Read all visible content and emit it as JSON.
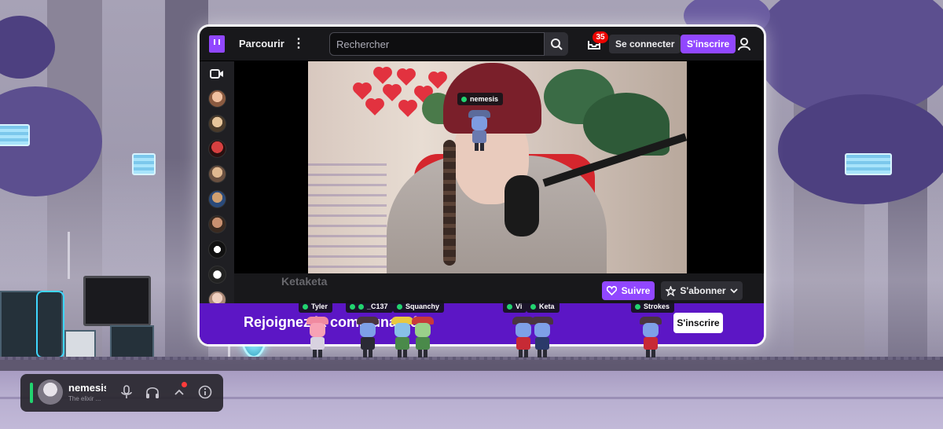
{
  "twitch": {
    "browse_label": "Parcourir",
    "search_placeholder": "Rechercher",
    "inbox_count": "35",
    "login_label": "Se connecter",
    "signup_label": "S'inscrire",
    "follow_label": "Suivre",
    "subscribe_label": "S'abonner",
    "channel_name": "Ketaketa",
    "promo_text": "Rejoignez la communauté",
    "promo_signup_label": "S'inscrire"
  },
  "players": [
    {
      "name": "nemesis"
    },
    {
      "name": "Tyler"
    },
    {
      "name": "_C137"
    },
    {
      "name": "Squanchy"
    },
    {
      "name": "Vi"
    },
    {
      "name": "Keta"
    },
    {
      "name": "Strokes"
    }
  ],
  "voice": {
    "username": "nemesis",
    "status": "The elixir ..."
  },
  "colors": {
    "twitch_purple": "#9147ff",
    "promo_purple": "#5c16c5",
    "online_green": "#22d36f",
    "badge_red": "#eb0400"
  }
}
